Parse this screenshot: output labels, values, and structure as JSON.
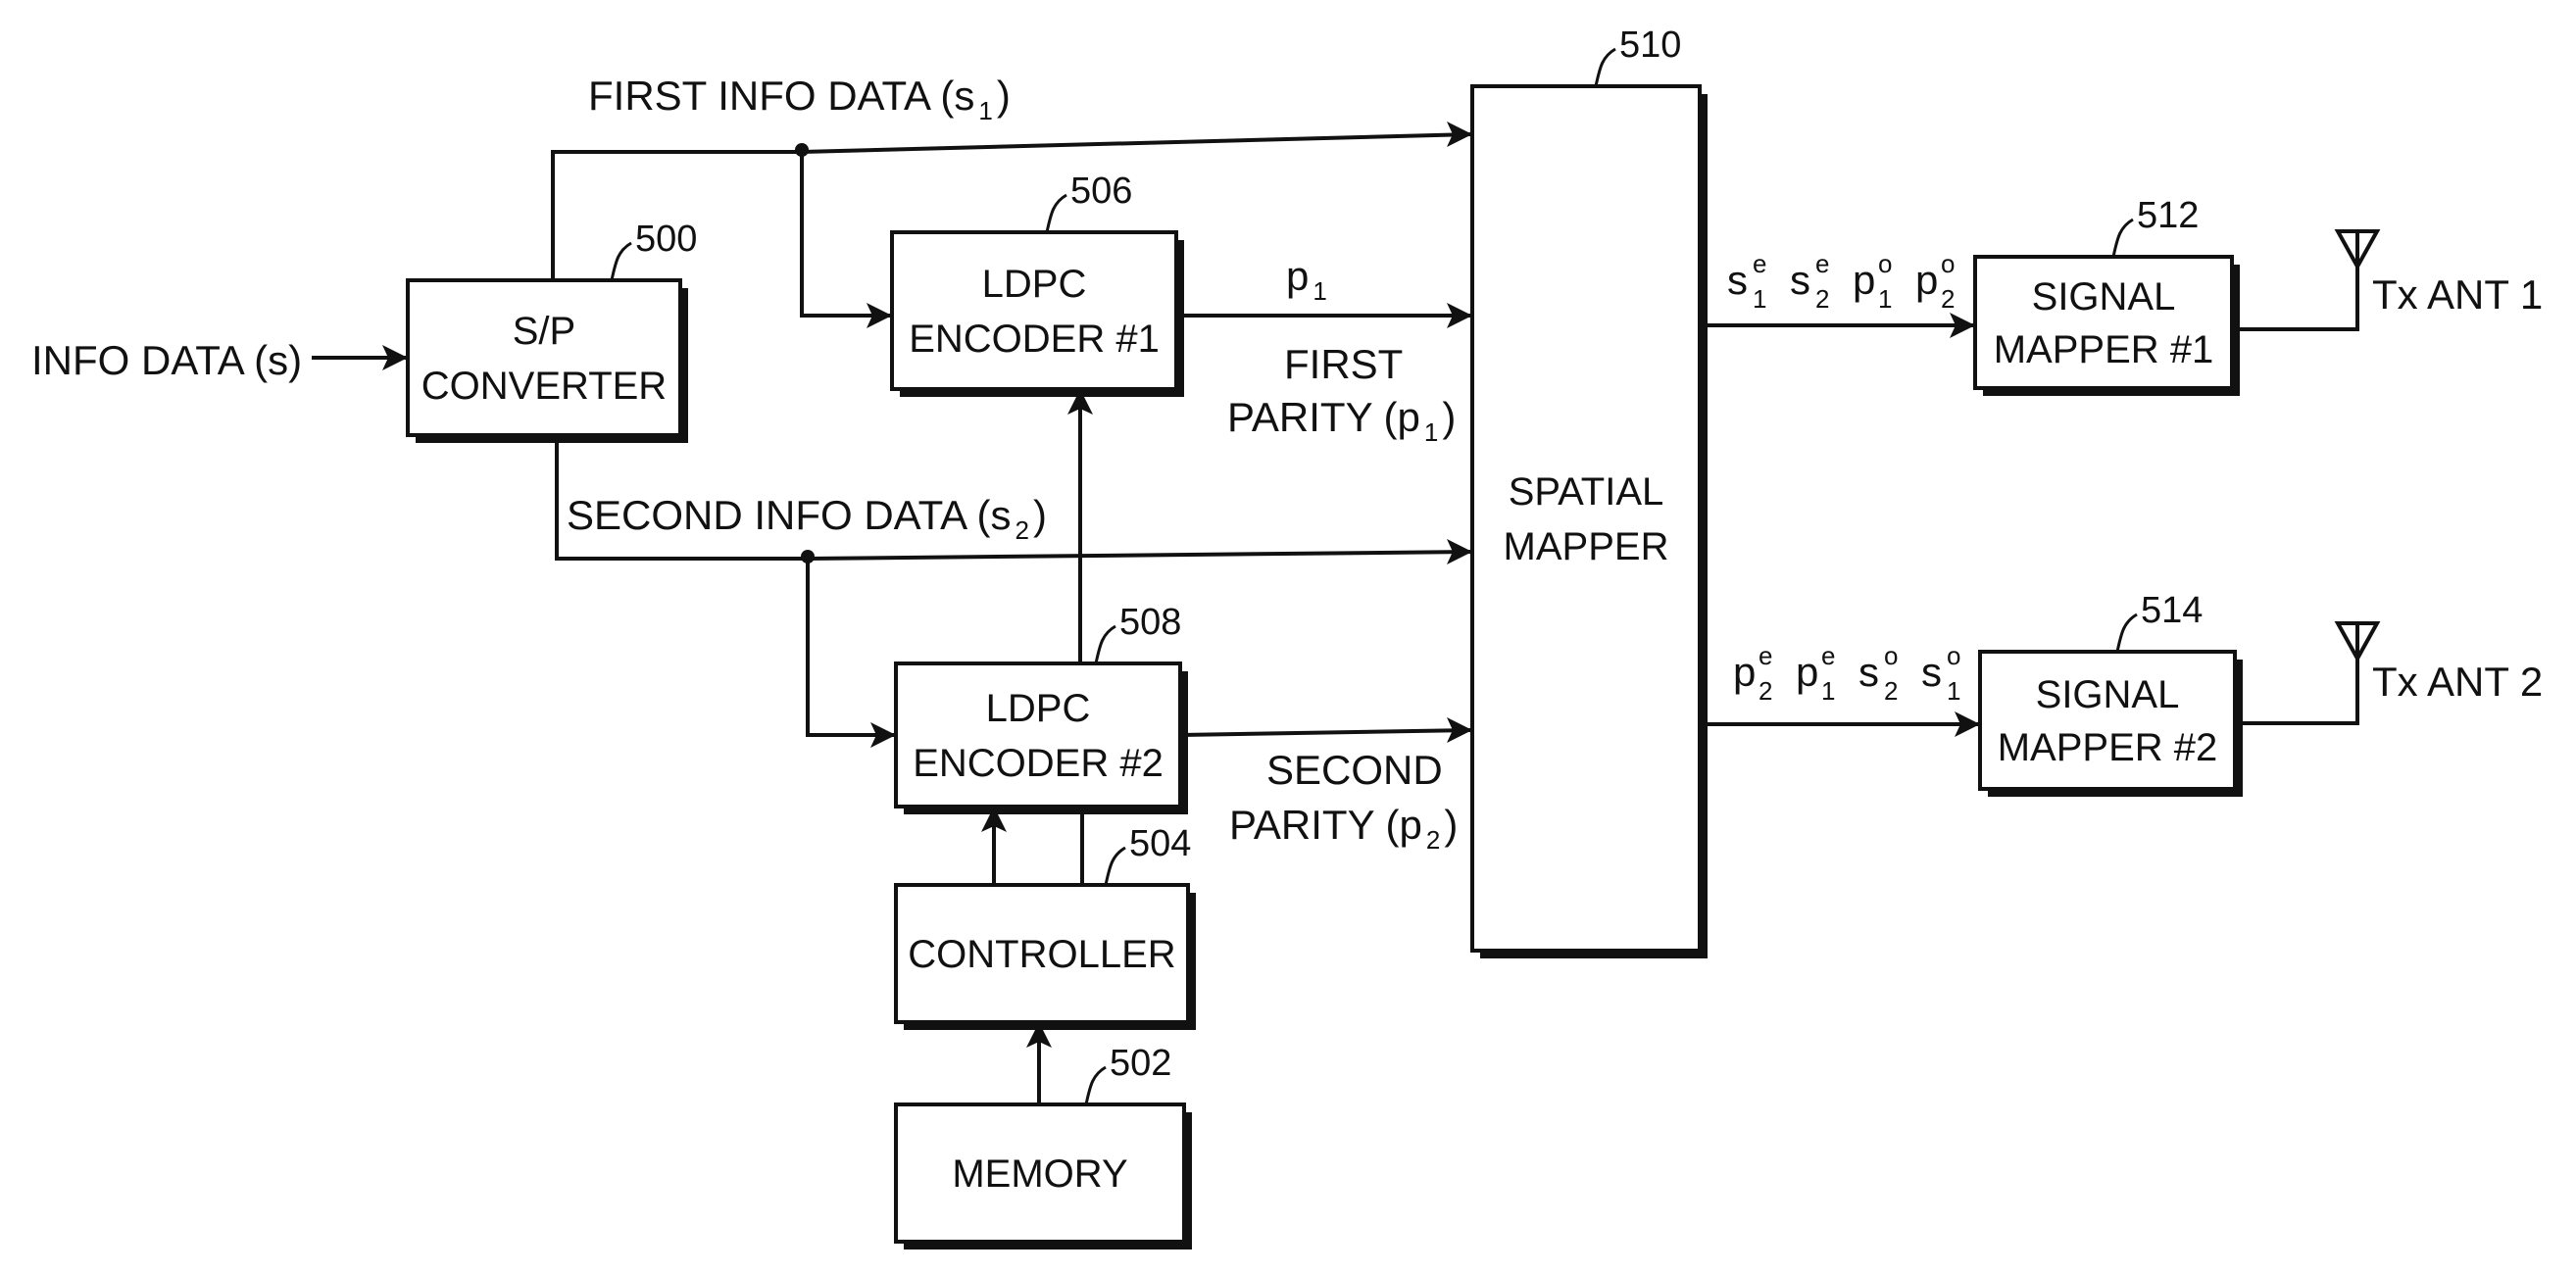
{
  "figure": {
    "blocks": {
      "sp_converter": {
        "ref": "500",
        "lines": [
          "S/P",
          "CONVERTER"
        ]
      },
      "memory": {
        "ref": "502",
        "lines": [
          "MEMORY"
        ]
      },
      "controller": {
        "ref": "504",
        "lines": [
          "CONTROLLER"
        ]
      },
      "ldpc_encoder_1": {
        "ref": "506",
        "lines": [
          "LDPC",
          "ENCODER #1"
        ]
      },
      "ldpc_encoder_2": {
        "ref": "508",
        "lines": [
          "LDPC",
          "ENCODER #2"
        ]
      },
      "spatial_mapper": {
        "ref": "510",
        "lines": [
          "SPATIAL",
          "MAPPER"
        ]
      },
      "signal_mapper_1": {
        "ref": "512",
        "lines": [
          "SIGNAL",
          "MAPPER #1"
        ]
      },
      "signal_mapper_2": {
        "ref": "514",
        "lines": [
          "SIGNAL",
          "MAPPER #2"
        ]
      }
    },
    "signals": {
      "input": {
        "text": "INFO DATA (s)"
      },
      "first_info": {
        "text": "FIRST INFO DATA (s",
        "sub": "1",
        "close": ")"
      },
      "second_info": {
        "text": "SECOND INFO DATA (s",
        "sub": "2",
        "close": ")"
      },
      "p1_symbol": {
        "base": "p",
        "sub": "1"
      },
      "first_parity": {
        "line1": "FIRST",
        "line2": "PARITY (p",
        "sub": "1",
        "close": ")"
      },
      "second_parity": {
        "line1": "SECOND",
        "line2": "PARITY (p",
        "sub": "2",
        "close": ")"
      },
      "out1_symbols": [
        {
          "base": "s",
          "sup": "e",
          "sub": "1"
        },
        {
          "base": "s",
          "sup": "e",
          "sub": "2"
        },
        {
          "base": "p",
          "sup": "o",
          "sub": "1"
        },
        {
          "base": "p",
          "sup": "o",
          "sub": "2"
        }
      ],
      "out2_symbols": [
        {
          "base": "p",
          "sup": "e",
          "sub": "2"
        },
        {
          "base": "p",
          "sup": "e",
          "sub": "1"
        },
        {
          "base": "s",
          "sup": "o",
          "sub": "2"
        },
        {
          "base": "s",
          "sup": "o",
          "sub": "1"
        }
      ]
    },
    "antennas": {
      "ant1": {
        "text": "Tx ANT 1"
      },
      "ant2": {
        "text": "Tx ANT 2"
      }
    }
  }
}
